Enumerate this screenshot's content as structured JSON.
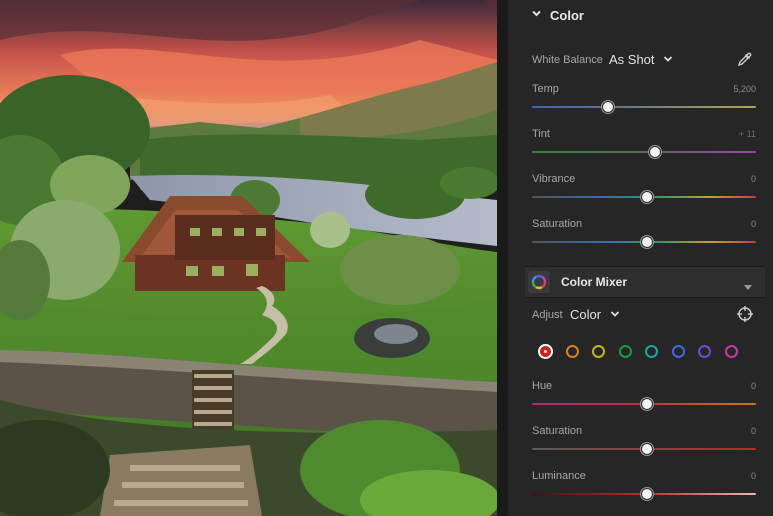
{
  "panel": {
    "color": {
      "title": "Color",
      "white_balance": {
        "label": "White Balance",
        "value": "As Shot"
      },
      "sliders": [
        {
          "id": "temp",
          "label": "Temp",
          "value": "5,200"
        },
        {
          "id": "tint",
          "label": "Tint",
          "value": "+ 11"
        },
        {
          "id": "vibrance",
          "label": "Vibrance",
          "value": "0"
        },
        {
          "id": "saturation",
          "label": "Saturation",
          "value": "0"
        }
      ]
    },
    "color_mixer": {
      "title": "Color Mixer",
      "adjust": {
        "label": "Adjust",
        "value": "Color"
      },
      "swatches": [
        {
          "name": "red",
          "color": "#d62020",
          "selected": true
        },
        {
          "name": "orange",
          "color": "#d8821c"
        },
        {
          "name": "yellow",
          "color": "#c9b21a"
        },
        {
          "name": "green",
          "color": "#1f9a3a"
        },
        {
          "name": "aqua",
          "color": "#1aa6a6"
        },
        {
          "name": "blue",
          "color": "#3a6ee0"
        },
        {
          "name": "purple",
          "color": "#7b45d6"
        },
        {
          "name": "magenta",
          "color": "#c63aa8"
        }
      ],
      "sliders": [
        {
          "id": "hue",
          "label": "Hue",
          "value": "0"
        },
        {
          "id": "mix-saturation",
          "label": "Saturation",
          "value": "0"
        },
        {
          "id": "luminance",
          "label": "Luminance",
          "value": "0"
        }
      ]
    },
    "icons": {
      "color_chevron": "chevron-down-icon",
      "white_balance_dropdown": "chevron-down-icon",
      "eyedropper": "eyedropper-icon",
      "mixer_icon": "color-wheel-icon",
      "mixer_menu": "triangle-down-icon",
      "adjust_dropdown": "chevron-down-icon",
      "targeted_adjust": "target-icon"
    }
  }
}
